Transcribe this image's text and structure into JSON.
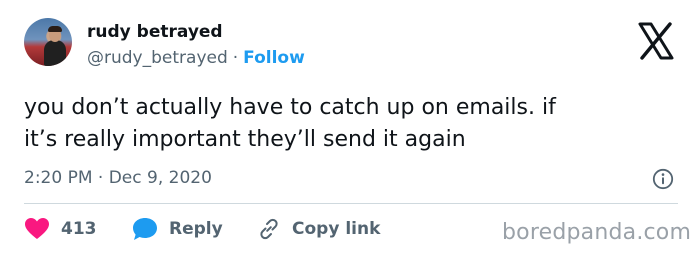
{
  "author": {
    "display_name": "rudy betrayed",
    "handle": "@rudy_betrayed",
    "separator": "·",
    "follow_label": "Follow"
  },
  "tweet": {
    "text": "you don’t actually have to catch up on emails. if\nit’s really important they’ll send it again",
    "timestamp": "2:20 PM · Dec 9, 2020"
  },
  "actions": {
    "likes_count": "413",
    "reply_label": "Reply",
    "copy_link_label": "Copy link"
  },
  "watermark": "boredpanda.com",
  "icons": {
    "brand": "x-logo-icon",
    "like": "heart-icon",
    "reply": "speech-bubble-icon",
    "copy": "link-icon",
    "info": "info-icon"
  },
  "colors": {
    "accent": "#1d9bf0",
    "like": "#f91880",
    "text": "#0f1419",
    "muted": "#536471",
    "divider": "#cfd9de"
  }
}
